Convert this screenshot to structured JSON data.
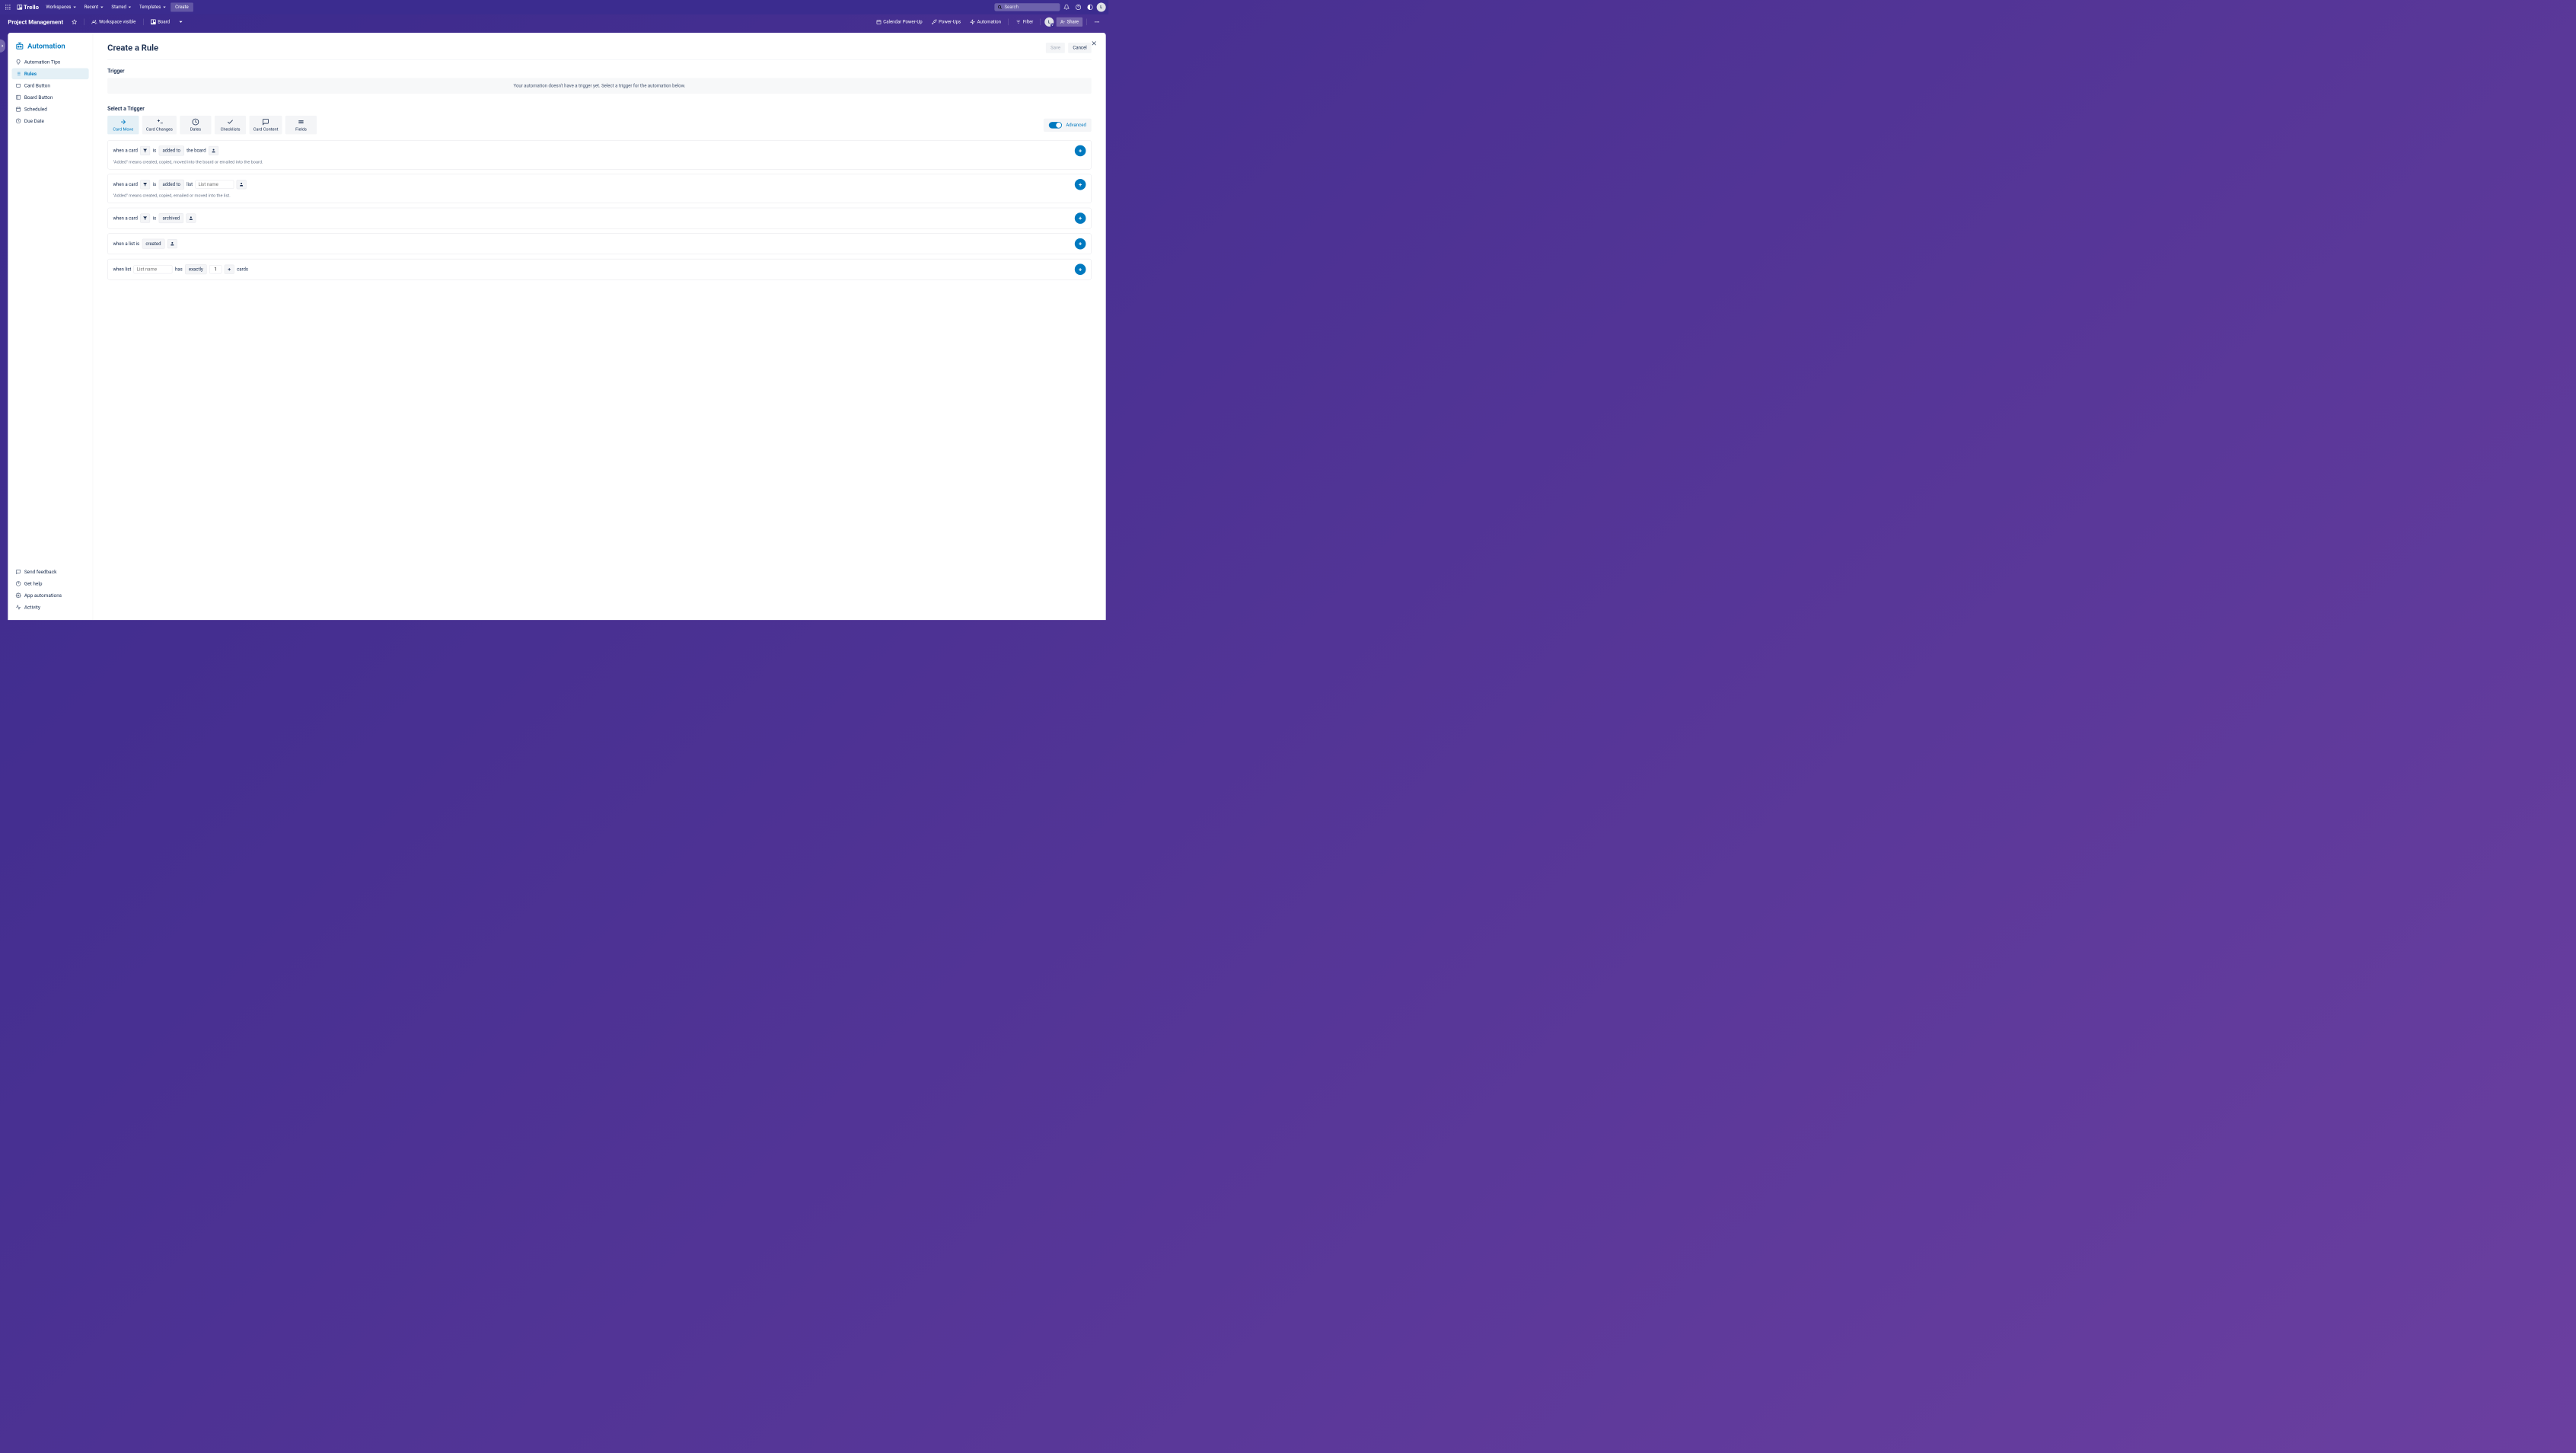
{
  "topbar": {
    "logo": "Trello",
    "nav": [
      "Workspaces",
      "Recent",
      "Starred",
      "Templates"
    ],
    "create": "Create",
    "search_placeholder": "Search",
    "avatar_initial": "L"
  },
  "boardbar": {
    "board_name": "Project Management",
    "workspace_visible": "Workspace visible",
    "board_btn": "Board",
    "calendar": "Calendar Power-Up",
    "powerups": "Power-Ups",
    "automation": "Automation",
    "filter": "Filter",
    "share": "Share",
    "avatar_initial": "L"
  },
  "sidebar": {
    "title": "Automation",
    "items": [
      {
        "label": "Automation Tips"
      },
      {
        "label": "Rules"
      },
      {
        "label": "Card Button"
      },
      {
        "label": "Board Button"
      },
      {
        "label": "Scheduled"
      },
      {
        "label": "Due Date"
      }
    ],
    "bottom": [
      {
        "label": "Send feedback"
      },
      {
        "label": "Get help"
      },
      {
        "label": "App automations"
      },
      {
        "label": "Activity"
      }
    ]
  },
  "content": {
    "title": "Create a Rule",
    "save": "Save",
    "cancel": "Cancel",
    "trigger_label": "Trigger",
    "trigger_info": "Your automation doesn't have a trigger yet. Select a trigger for the automation below.",
    "select_trigger": "Select a Trigger",
    "tabs": [
      "Card Move",
      "Card Changes",
      "Dates",
      "Checklists",
      "Card Content",
      "Fields"
    ],
    "advanced": "Advanced",
    "rules": {
      "r1": {
        "when": "when a card",
        "is": "is",
        "added_to": "added to",
        "the_board": "the board",
        "note": "\"Added\" means created, copied, moved into the board or emailed into the board."
      },
      "r2": {
        "when": "when a card",
        "is": "is",
        "added_to": "added to",
        "list": "list",
        "placeholder": "List name",
        "note": "\"Added\" means created, copied, emailed or moved into the list."
      },
      "r3": {
        "when": "when a card",
        "is": "is",
        "archived": "archived"
      },
      "r4": {
        "when": "when a list is",
        "created": "created"
      },
      "r5": {
        "when": "when list",
        "placeholder": "List name",
        "has": "has",
        "exactly": "exactly",
        "count": "1",
        "cards": "cards"
      }
    }
  }
}
